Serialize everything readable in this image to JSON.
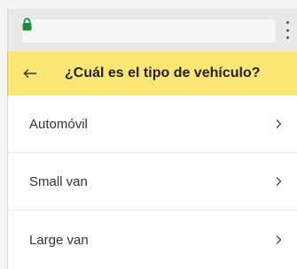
{
  "header": {
    "title": "¿Cuál es el tipo de vehículo?"
  },
  "vehicle_types": [
    {
      "label": "Automóvil"
    },
    {
      "label": "Small van"
    },
    {
      "label": "Large van"
    }
  ],
  "colors": {
    "header_bg": "#fce775",
    "lock_green": "#1a8f3a"
  },
  "icons": {
    "secure": "lock-icon",
    "menu": "more-vert-icon",
    "back": "arrow-left-icon",
    "chevron": "chevron-right-icon"
  }
}
